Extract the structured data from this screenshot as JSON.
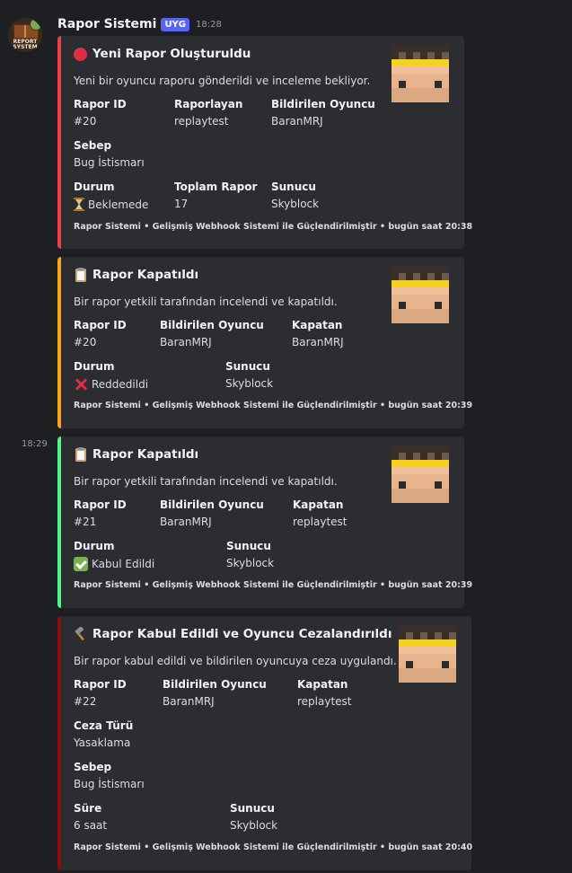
{
  "app": {
    "username": "Rapor Sistemi",
    "tag": "UYG",
    "time": "18:28",
    "side_time": "18:29",
    "avatar_text": [
      "REPORT",
      "SYSTEM"
    ]
  },
  "embeds": [
    {
      "color": "#ed4245",
      "icon": "red-circle-icon",
      "title": "Yeni Rapor Oluşturuldu",
      "description": "Yeni bir oyuncu raporu gönderildi ve inceleme bekliyor.",
      "fields": [
        {
          "name": "Rapor ID",
          "value": "#20"
        },
        {
          "name": "Raporlayan",
          "value": "replaytest"
        },
        {
          "name": "Bildirilen Oyuncu",
          "value": "BaranMRJ"
        },
        {
          "name": "Sebep",
          "value": "Bug İstismarı"
        },
        {
          "name": "Durum",
          "value": "Beklemede",
          "icon": "hourglass-icon"
        },
        {
          "name": "Toplam Rapor",
          "value": "17"
        },
        {
          "name": "Sunucu",
          "value": "Skyblock"
        }
      ],
      "footer": "Rapor Sistemi • Gelişmiş Webhook Sistemi ile Güçlendirilmiştir • bugün saat 20:38"
    },
    {
      "color": "#faa61a",
      "icon": "clipboard-icon",
      "title": "Rapor Kapatıldı",
      "description": "Bir rapor yetkili tarafından incelendi ve kapatıldı.",
      "fields": [
        {
          "name": "Rapor ID",
          "value": "#20"
        },
        {
          "name": "Bildirilen Oyuncu",
          "value": "BaranMRJ"
        },
        {
          "name": "Kapatan",
          "value": "BaranMRJ"
        },
        {
          "name": "Durum",
          "value": "Reddedildi",
          "icon": "cross-mark-icon"
        },
        {
          "name": "Sunucu",
          "value": "Skyblock"
        }
      ],
      "footer": "Rapor Sistemi • Gelişmiş Webhook Sistemi ile Güçlendirilmiştir • bugün saat 20:39"
    },
    {
      "color": "#57f287",
      "icon": "clipboard-icon",
      "title": "Rapor Kapatıldı",
      "description": "Bir rapor yetkili tarafından incelendi ve kapatıldı.",
      "fields": [
        {
          "name": "Rapor ID",
          "value": "#21"
        },
        {
          "name": "Bildirilen Oyuncu",
          "value": "BaranMRJ"
        },
        {
          "name": "Kapatan",
          "value": "replaytest"
        },
        {
          "name": "Durum",
          "value": "Kabul Edildi",
          "icon": "check-mark-icon"
        },
        {
          "name": "Sunucu",
          "value": "Skyblock"
        }
      ],
      "footer": "Rapor Sistemi • Gelişmiş Webhook Sistemi ile Güçlendirilmiştir • bugün saat 20:39"
    },
    {
      "color": "#8b0e0e",
      "icon": "hammer-icon",
      "title": "Rapor Kabul Edildi ve Oyuncu Cezalandırıldı",
      "description": "Bir rapor kabul edildi ve bildirilen oyuncuya ceza uygulandı.",
      "fields": [
        {
          "name": "Rapor ID",
          "value": "#22"
        },
        {
          "name": "Bildirilen Oyuncu",
          "value": "BaranMRJ"
        },
        {
          "name": "Kapatan",
          "value": "replaytest"
        },
        {
          "name": "Ceza Türü",
          "value": "Yasaklama"
        },
        {
          "name": "Sebep",
          "value": "Bug İstismarı"
        },
        {
          "name": "Süre",
          "value": "6 saat"
        },
        {
          "name": "Sunucu",
          "value": "Skyblock"
        }
      ],
      "footer": "Rapor Sistemi • Gelişmiş Webhook Sistemi ile Güçlendirilmiştir • bugün saat 20:40"
    }
  ]
}
